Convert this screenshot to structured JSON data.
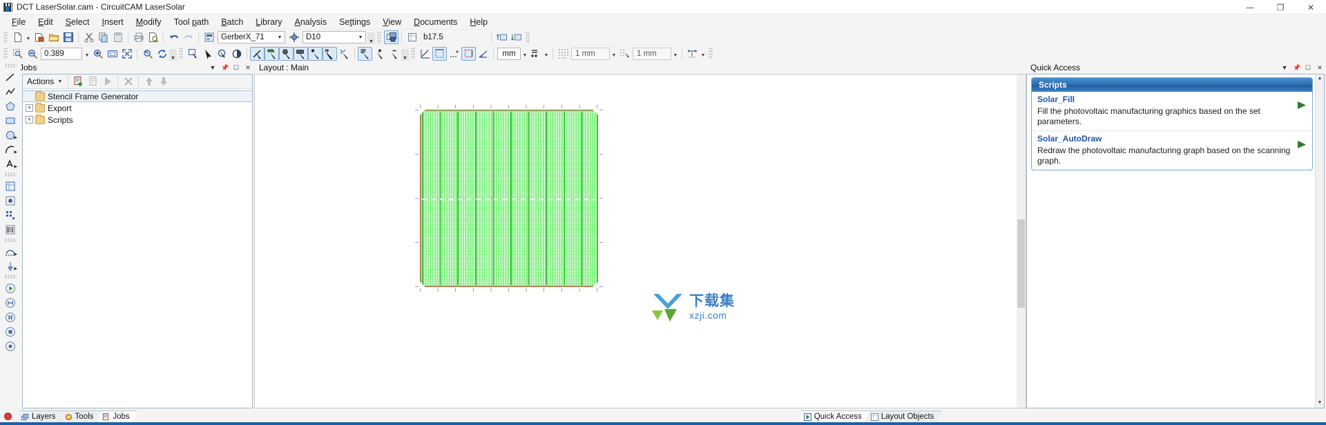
{
  "window": {
    "title": "DCT LaserSolar.cam - CircuitCAM LaserSolar",
    "icon": "app-grid-icon",
    "minimize": "—",
    "maximize": "❐",
    "close": "✕"
  },
  "menubar": {
    "items": [
      {
        "label": "File",
        "accel": "F"
      },
      {
        "label": "Edit",
        "accel": "E"
      },
      {
        "label": "Select",
        "accel": "S"
      },
      {
        "label": "Insert",
        "accel": "I"
      },
      {
        "label": "Modify",
        "accel": "M"
      },
      {
        "label": "Tool path",
        "accel": "p"
      },
      {
        "label": "Batch",
        "accel": "B"
      },
      {
        "label": "Library",
        "accel": "L"
      },
      {
        "label": "Analysis",
        "accel": "A"
      },
      {
        "label": "Settings",
        "accel": "t"
      },
      {
        "label": "View",
        "accel": "V"
      },
      {
        "label": "Documents",
        "accel": "D"
      },
      {
        "label": "Help",
        "accel": "H"
      }
    ]
  },
  "toolbar_main": {
    "format_selector": "GerberX_71",
    "aperture_selector": "D10",
    "layer_value": "b17.5"
  },
  "toolbar_view": {
    "zoom_value": "0.389",
    "unit": "mm",
    "grid_value": "1 mm",
    "snap_value": "1 mm"
  },
  "jobs_panel": {
    "caption": "Jobs",
    "actions_label": "Actions",
    "tree": [
      {
        "label": "Stencil Frame Generator",
        "expandable": false,
        "selected": true
      },
      {
        "label": "Export",
        "expandable": true,
        "expander": "+",
        "selected": false
      },
      {
        "label": "Scripts",
        "expandable": true,
        "expander": "+",
        "selected": false
      }
    ]
  },
  "document": {
    "caption": "Layout : Main"
  },
  "watermark": {
    "chinese": "下载集",
    "latin": "xzji.com"
  },
  "quick_access": {
    "caption": "Quick Access",
    "groups": [
      {
        "title": "Scripts",
        "items": [
          {
            "name": "Solar_Fill",
            "description": "Fill the photovoltaic manufacturing graphics based on the set parameters.",
            "run_icon": "play-icon"
          },
          {
            "name": "Solar_AutoDraw",
            "description": "Redraw the photovoltaic manufacturing graph based on the scanning graph.",
            "run_icon": "play-icon"
          }
        ]
      }
    ]
  },
  "bottom_tabs_left": [
    {
      "label": "Layers",
      "icon": "layers-icon",
      "active": false
    },
    {
      "label": "Tools",
      "icon": "tools-icon",
      "active": false
    },
    {
      "label": "Jobs",
      "icon": "jobs-icon",
      "active": true
    }
  ],
  "bottom_tabs_right": [
    {
      "label": "Quick Access",
      "icon": "quick-access-icon",
      "active": true
    },
    {
      "label": "Layout Objects",
      "icon": "layout-objects-icon",
      "active": false
    }
  ],
  "colors": {
    "accent": "#2e6fae",
    "link": "#2255a8",
    "panel_border": "#9fb6c9",
    "solar_green": "#7ef07e",
    "solar_outline": "#d03a3a",
    "status_blue": "#1d5fa8",
    "record_red": "#e03b3b"
  }
}
